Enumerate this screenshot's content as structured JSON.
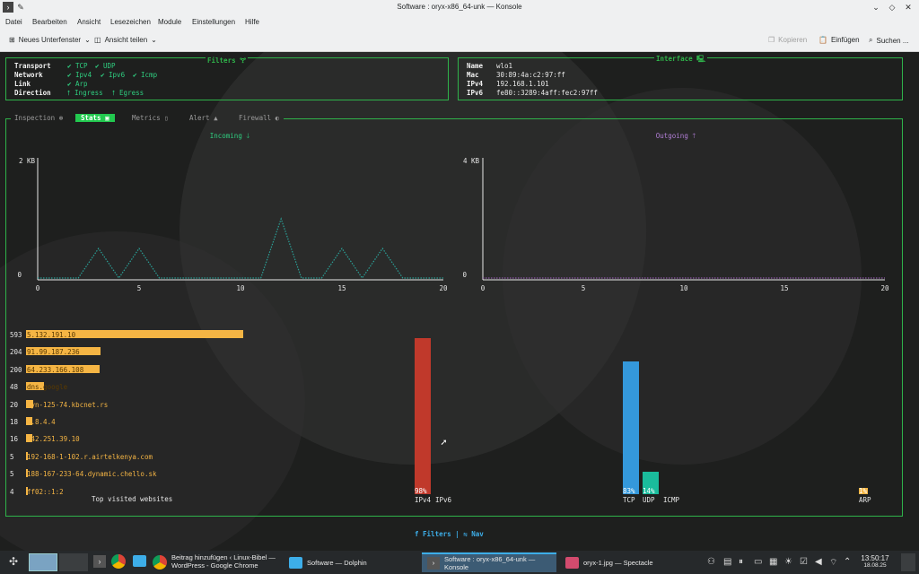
{
  "window": {
    "title": "Software : oryx-x86_64-unk — Konsole"
  },
  "menu": [
    "Datei",
    "Bearbeiten",
    "Ansicht",
    "Lesezeichen",
    "Module",
    "Einstellungen",
    "Hilfe"
  ],
  "toolbar": {
    "new_tab": "Neues Unterfenster",
    "split": "Ansicht teilen",
    "copy": "Kopieren",
    "paste": "Einfügen",
    "search": "Suchen ..."
  },
  "filters": {
    "title": "Filters 🝖",
    "rows": [
      {
        "label": "Transport",
        "items": [
          "✔ TCP",
          "✔ UDP"
        ]
      },
      {
        "label": "Network",
        "items": [
          "✔ Ipv4",
          "✔ Ipv6",
          "✔ Icmp"
        ]
      },
      {
        "label": "Link",
        "items": [
          "✔ Arp"
        ]
      },
      {
        "label": "Direction",
        "items": [
          "⭡ Ingress",
          "⭡ Egress"
        ]
      }
    ]
  },
  "interface": {
    "title": "Interface 🖳",
    "rows": [
      {
        "label": "Name",
        "value": "wlo1"
      },
      {
        "label": "Mac",
        "value": "30:89:4a:c2:97:ff"
      },
      {
        "label": "IPv4",
        "value": "192.168.1.101"
      },
      {
        "label": "IPv6",
        "value": "fe80::3289:4aff:fec2:97ff"
      }
    ]
  },
  "tabs": [
    {
      "label": "Inspection ⊛",
      "active": false
    },
    {
      "label": "Stats ▣",
      "active": true
    },
    {
      "label": "Metrics ▯",
      "active": false
    },
    {
      "label": "Alert ▲",
      "active": false
    },
    {
      "label": "Firewall ◐",
      "active": false
    }
  ],
  "incoming": {
    "title": "Incoming 🡓",
    "ymax_label": "2 KB",
    "ymin_label": "0",
    "xticks": [
      "0",
      "5",
      "10",
      "15",
      "20"
    ]
  },
  "outgoing": {
    "title": "Outgoing 🡑",
    "ymax_label": "4 KB",
    "ymin_label": "0",
    "xticks": [
      "0",
      "5",
      "10",
      "15",
      "20"
    ]
  },
  "websites": {
    "caption": "Top visited websites",
    "items": [
      {
        "count": "593",
        "name": "5.132.191.10",
        "value": 593
      },
      {
        "count": "204",
        "name": "91.99.187.236",
        "value": 204
      },
      {
        "count": "200",
        "name": "64.233.166.108",
        "value": 200
      },
      {
        "count": "48",
        "name": "dns.google",
        "value": 48
      },
      {
        "count": "20",
        "name": "dyn-125-74.kbcnet.rs",
        "value": 20
      },
      {
        "count": "18",
        "name": "8.8.4.4",
        "value": 18
      },
      {
        "count": "16",
        "name": "142.251.39.10",
        "value": 16
      },
      {
        "count": "5",
        "name": "192-168-1-102.r.airtelkenya.com",
        "value": 5
      },
      {
        "count": "5",
        "name": "188-167-233-64.dynamic.chello.sk",
        "value": 5
      },
      {
        "count": "4",
        "name": "ff02::1:2",
        "value": 4
      }
    ]
  },
  "protocol_bars": [
    {
      "name": "IPv4",
      "pct": "98%",
      "value": 98,
      "color": "#c0392b"
    },
    {
      "name": "IPv6",
      "pct": "",
      "value": 0,
      "color": "#c0392b"
    },
    {
      "name": "TCP",
      "pct": "83%",
      "value": 83,
      "color": "#3498db"
    },
    {
      "name": "UDP",
      "pct": "14%",
      "value": 14,
      "color": "#1abc9c"
    },
    {
      "name": "ICMP",
      "pct": "",
      "value": 0,
      "color": "#1abc9c"
    },
    {
      "name": "ARP",
      "pct": "1%",
      "value": 1,
      "color": "#f5b544"
    }
  ],
  "footer": "f Filters | ⇋ Nav",
  "taskbar": {
    "tasks": [
      {
        "title": "Beitrag hinzufügen ‹ Linux-Bibel — WordPress - Google Chrome"
      },
      {
        "title": "Software — Dolphin"
      },
      {
        "title": "Software : oryx-x86_64-unk — Konsole"
      },
      {
        "title": "oryx-1.jpg — Spectacle"
      }
    ],
    "time": "13:50:17",
    "date": "18.08.25"
  },
  "colors": {
    "incoming_line": "#2aa198",
    "outgoing_line": "#8e5aa8",
    "accent": "#2fb34a"
  },
  "chart_data": [
    {
      "type": "line",
      "title": "Incoming 🡓",
      "x": [
        0,
        1,
        2,
        3,
        4,
        5,
        6,
        7,
        8,
        9,
        10,
        11,
        12,
        13,
        14,
        15,
        16,
        17,
        18,
        19,
        20
      ],
      "values": [
        0,
        0,
        0,
        0.5,
        0,
        0.5,
        0,
        0,
        0,
        0,
        0,
        0,
        1.0,
        0,
        0,
        0.5,
        0,
        0.5,
        0,
        0,
        0
      ],
      "xlim": [
        0,
        20
      ],
      "ylim": [
        0,
        2
      ],
      "ylabel": ""
    },
    {
      "type": "line",
      "title": "Outgoing 🡑",
      "x": [
        0,
        1,
        2,
        3,
        4,
        5,
        6,
        7,
        8,
        9,
        10,
        11,
        12,
        13,
        14,
        15,
        16,
        17,
        18,
        19,
        20
      ],
      "values": [
        0,
        0,
        0,
        0,
        0,
        0,
        0,
        0,
        0,
        0,
        0,
        0,
        0,
        0,
        0,
        0,
        0,
        0,
        0,
        0,
        0
      ],
      "xlim": [
        0,
        20
      ],
      "ylim": [
        0,
        4
      ]
    }
  ]
}
